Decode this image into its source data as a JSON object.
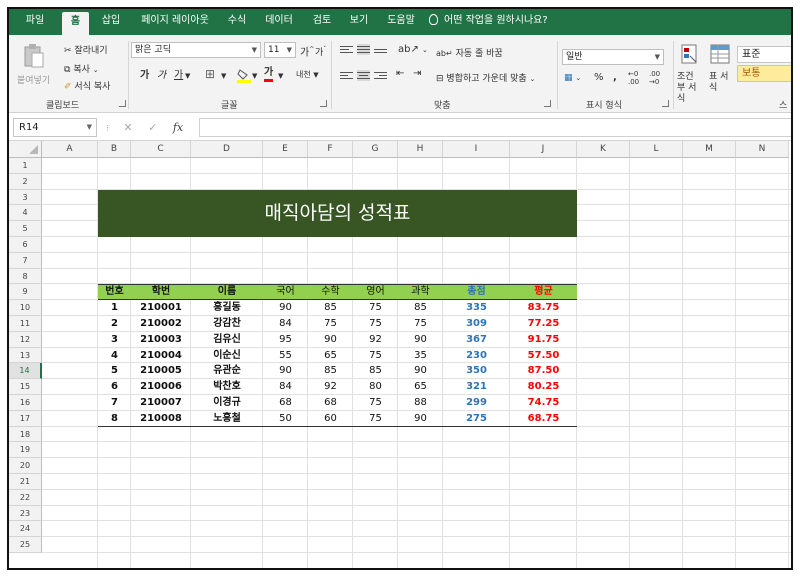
{
  "ribbon_tabs": [
    "파일",
    "홈",
    "삽입",
    "페이지 레이아웃",
    "수식",
    "데이터",
    "검토",
    "보기",
    "도움말",
    "어떤 작업을 원하시나요?"
  ],
  "active_tab": "홈",
  "clipboard": {
    "paste": "붙여넣기",
    "cut": "잘라내기",
    "copy": "복사",
    "format_painter": "서식 복사",
    "group_label": "클립보드"
  },
  "font": {
    "family": "맑은 고딕",
    "size": "11",
    "grow": "가",
    "shrink": "가",
    "bold": "가",
    "italic": "가",
    "underline": "가",
    "font_color": "가",
    "phonetic": "내천",
    "group_label": "글꼴"
  },
  "alignment": {
    "wrap_text": "자동 줄 바꿈",
    "merge_center": "병합하고 가운데 맞춤",
    "group_label": "맞춤"
  },
  "number": {
    "format": "일반",
    "percent": "%",
    "comma": ",",
    "group_label": "표시 형식"
  },
  "styles": {
    "conditional": "조건부 서식",
    "table": "표 서식",
    "normal": "표준",
    "neutral": "보통",
    "group_label_partial": "스"
  },
  "formula_bar": {
    "name_box": "R14",
    "fx": "fx",
    "content": ""
  },
  "columns": [
    "A",
    "B",
    "C",
    "D",
    "E",
    "F",
    "G",
    "H",
    "I",
    "J",
    "K",
    "L",
    "M",
    "N"
  ],
  "rows": [
    "1",
    "2",
    "3",
    "4",
    "5",
    "6",
    "7",
    "8",
    "9",
    "10",
    "11",
    "12",
    "13",
    "14",
    "15",
    "16",
    "17",
    "18",
    "19",
    "20",
    "21",
    "22",
    "23",
    "24",
    "25"
  ],
  "selected_row": "14",
  "sheet": {
    "title": "매직아담의 성적표",
    "headers": [
      "번호",
      "학번",
      "이름",
      "국어",
      "수학",
      "영어",
      "과학",
      "총점",
      "평균"
    ],
    "records": [
      [
        "1",
        "210001",
        "홍길동",
        "90",
        "85",
        "75",
        "85",
        "335",
        "83.75"
      ],
      [
        "2",
        "210002",
        "강감찬",
        "84",
        "75",
        "75",
        "75",
        "309",
        "77.25"
      ],
      [
        "3",
        "210003",
        "김유신",
        "95",
        "90",
        "92",
        "90",
        "367",
        "91.75"
      ],
      [
        "4",
        "210004",
        "이순신",
        "55",
        "65",
        "75",
        "35",
        "230",
        "57.50"
      ],
      [
        "5",
        "210005",
        "유관순",
        "90",
        "85",
        "85",
        "90",
        "350",
        "87.50"
      ],
      [
        "6",
        "210006",
        "박찬호",
        "84",
        "92",
        "80",
        "65",
        "321",
        "80.25"
      ],
      [
        "7",
        "210007",
        "이경규",
        "68",
        "68",
        "75",
        "88",
        "299",
        "74.75"
      ],
      [
        "8",
        "210008",
        "노홍철",
        "50",
        "60",
        "75",
        "90",
        "275",
        "68.75"
      ]
    ]
  },
  "colors": {
    "ribbon_green": "#217346",
    "title_fill": "#375623",
    "header_fill": "#92d050",
    "total_blue": "#2e75b6",
    "average_red": "#ff0000"
  }
}
